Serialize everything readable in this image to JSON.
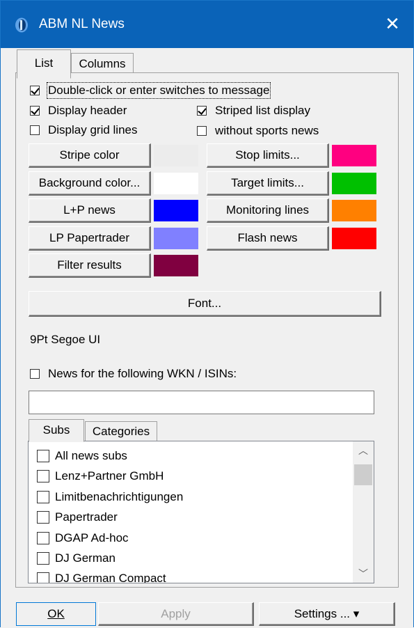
{
  "window": {
    "title": "ABM NL News",
    "close_glyph": "✕",
    "icon": "app-logo-icon",
    "titlebar_color": "#0a63b8"
  },
  "tabs": {
    "list": "List",
    "columns": "Columns",
    "active": "List"
  },
  "options": {
    "double_click": {
      "label": "Double-click or enter switches to message",
      "checked": true
    },
    "display_header": {
      "label": "Display header",
      "checked": true
    },
    "display_grid": {
      "label": "Display grid lines",
      "checked": false
    },
    "striped": {
      "label": "Striped list display",
      "checked": true
    },
    "no_sports": {
      "label": "without sports news",
      "checked": false
    }
  },
  "color_buttons": {
    "stripe": {
      "label": "Stripe color",
      "color": "#ececec"
    },
    "background": {
      "label": "Background color...",
      "color": "#ffffff"
    },
    "lp_news": {
      "label": "L+P news",
      "color": "#0000ff"
    },
    "lp_papertrader": {
      "label": "LP Papertrader",
      "color": "#8080ff"
    },
    "filter_results": {
      "label": "Filter results",
      "color": "#800040"
    },
    "stop_limits": {
      "label": "Stop limits...",
      "color": "#ff0080"
    },
    "target_limits": {
      "label": "Target limits...",
      "color": "#00c000"
    },
    "monitoring_lines": {
      "label": "Monitoring lines",
      "color": "#ff8000"
    },
    "flash_news": {
      "label": "Flash news",
      "color": "#ff0000"
    }
  },
  "font": {
    "button": "Font...",
    "current": "9Pt Segoe UI"
  },
  "wkn": {
    "label": "News for the following WKN / ISINs:",
    "checked": false,
    "value": ""
  },
  "subtabs": {
    "subs": "Subs",
    "categories": "Categories",
    "active": "Subs"
  },
  "subs_list": [
    {
      "label": "All news subs",
      "checked": false
    },
    {
      "label": "Lenz+Partner GmbH",
      "checked": false
    },
    {
      "label": "Limitbenachrichtigungen",
      "checked": false
    },
    {
      "label": "Papertrader",
      "checked": false
    },
    {
      "label": "DGAP Ad-hoc",
      "checked": false
    },
    {
      "label": "DJ German",
      "checked": false
    },
    {
      "label": "DJ German Compact",
      "checked": false
    }
  ],
  "footer": {
    "ok": "OK",
    "apply": "Apply",
    "settings": "Settings ... ▾"
  }
}
